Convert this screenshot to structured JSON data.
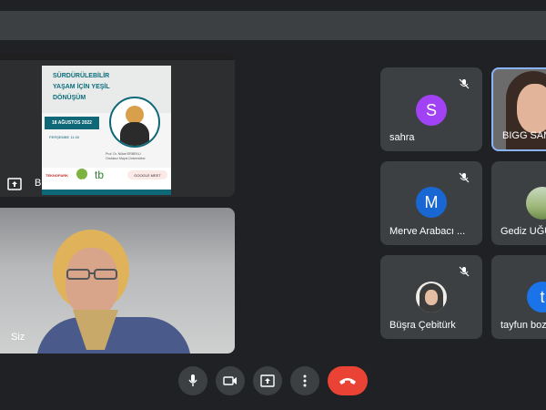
{
  "presentation": {
    "label": "BIGG SAMSUN (Sunu)",
    "slide": {
      "title_line1": "SÜRDÜRÜLEBİLİR",
      "title_line2": "YAŞAM İÇİN YEŞİL",
      "title_line3": "DÖNÜŞÜM",
      "date": "18 AĞUSTOS 2022",
      "day_time": "PERŞEMBE 11:00",
      "speaker": "Prof. Dr. Nüket ERBEKLI",
      "speaker_sub": "Ondokuz Mayıs Üniversitesi",
      "logo1": "TEKNOPARK",
      "logo3": "GOOGLE MEET"
    }
  },
  "self_tile": {
    "name": "Siz"
  },
  "participants": [
    {
      "name": "sahra",
      "initial": "S",
      "color": "#a142f4",
      "muted": true
    },
    {
      "name": "BIGG SAMSUN",
      "muted": false
    },
    {
      "name": "Merve Arabacı ...",
      "initial": "M",
      "color": "#1967d2",
      "muted": true
    },
    {
      "name": "Gediz UĞUR",
      "muted": false
    },
    {
      "name": "Büşra Çebitürk",
      "muted": true
    },
    {
      "name": "tayfun bozkurt",
      "initial": "t",
      "color": "#1a73e8",
      "muted": false
    }
  ],
  "controls": {
    "mic": "microphone-icon",
    "camera": "camera-icon",
    "present": "present-screen-icon",
    "more": "more-options-icon",
    "end": "end-call-icon"
  }
}
